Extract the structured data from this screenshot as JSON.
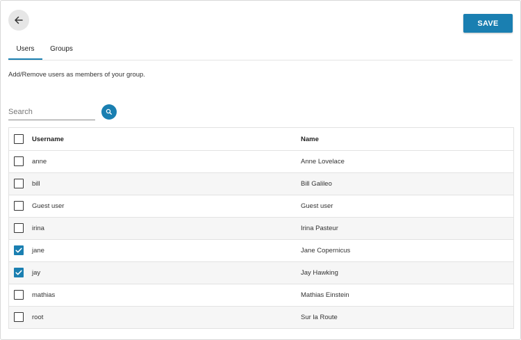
{
  "toolbar": {
    "back_icon": "arrow-left-icon",
    "save_label": "SAVE"
  },
  "tabs": [
    {
      "label": "Users",
      "active": true
    },
    {
      "label": "Groups",
      "active": false
    }
  ],
  "description": "Add/Remove users as members of your group.",
  "search": {
    "placeholder": "Search",
    "value": "",
    "icon": "search-icon"
  },
  "table": {
    "columns": [
      "Username",
      "Name"
    ],
    "select_all_checked": false,
    "rows": [
      {
        "username": "anne",
        "name": "Anne Lovelace",
        "checked": false
      },
      {
        "username": "bill",
        "name": "Bill Galileo",
        "checked": false
      },
      {
        "username": "Guest user",
        "name": "Guest user",
        "checked": false
      },
      {
        "username": "irina",
        "name": "Irina Pasteur",
        "checked": false
      },
      {
        "username": "jane",
        "name": "Jane Copernicus",
        "checked": true
      },
      {
        "username": "jay",
        "name": "Jay Hawking",
        "checked": true
      },
      {
        "username": "mathias",
        "name": "Mathias Einstein",
        "checked": false
      },
      {
        "username": "root",
        "name": "Sur la Route",
        "checked": false
      }
    ]
  },
  "colors": {
    "accent": "#1a7fb1",
    "back_button_bg": "#e6e6e6",
    "row_alt_bg": "#f6f6f6"
  }
}
